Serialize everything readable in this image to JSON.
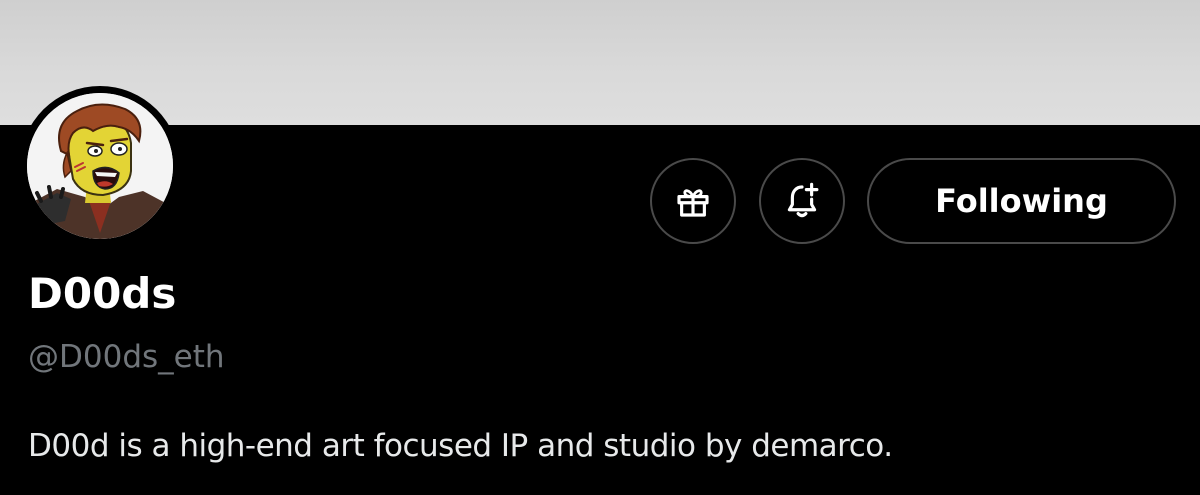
{
  "profile": {
    "display_name": "D00ds",
    "handle": "@D00ds_eth",
    "bio": "D00d is a high-end art focused IP and studio by demarco.",
    "avatar_description": "cartoon avatar"
  },
  "actions": {
    "gift_icon": "gift-icon",
    "notify_icon": "bell-plus-icon",
    "following_label": "Following"
  },
  "colors": {
    "background": "#000000",
    "banner": "#d8d8d8",
    "text_primary": "#ffffff",
    "text_secondary": "#71767b",
    "button_border": "#4a4a4a"
  }
}
